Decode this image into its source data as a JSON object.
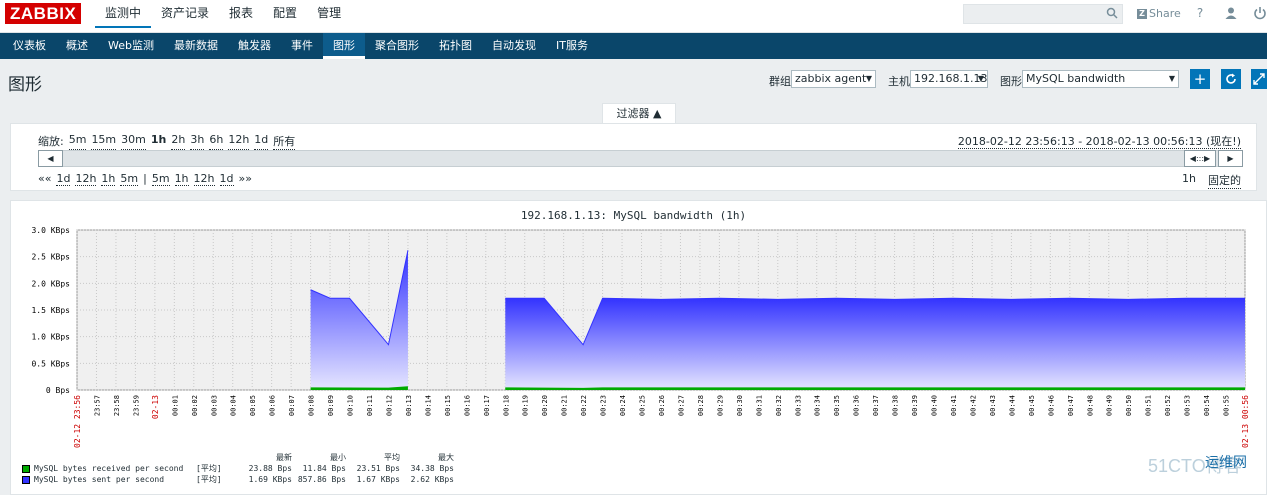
{
  "topbar": {
    "logo": "ZABBIX",
    "menu": [
      "监测中",
      "资产记录",
      "报表",
      "配置",
      "管理"
    ],
    "share_label": "Share",
    "share_icon": "Z",
    "help": "?",
    "user_icon": "user-icon",
    "logout_icon": "power-icon"
  },
  "subnav": [
    "仪表板",
    "概述",
    "Web监测",
    "最新数据",
    "触发器",
    "事件",
    "图形",
    "聚合图形",
    "拓扑图",
    "自动发现",
    "IT服务"
  ],
  "page": {
    "title": "图形",
    "group_label": "群组",
    "group_value": "zabbix agent",
    "host_label": "主机",
    "host_value": "192.168.1.13",
    "graph_label": "图形",
    "graph_value": "MySQL bandwidth",
    "filter_tab": "过滤器 ▲"
  },
  "filter": {
    "zoom_label": "缩放:",
    "zoom_options": [
      "5m",
      "15m",
      "30m",
      "1h",
      "2h",
      "3h",
      "6h",
      "12h",
      "1d",
      "所有"
    ],
    "zoom_current": "1h",
    "range_text": "2018-02-12 23:56:13 - 2018-02-13 00:56:13 (现在!)",
    "nav_back": [
      "««",
      "1d",
      "12h",
      "1h",
      "5m",
      "|",
      "5m",
      "1h",
      "12h",
      "1d",
      "»»"
    ],
    "period": "1h",
    "fixed": "固定的"
  },
  "chart_data": {
    "type": "area",
    "title": "192.168.1.13: MySQL bandwidth (1h)",
    "ylabel": "",
    "y_unit": "KBps",
    "ylim": [
      0,
      3.0
    ],
    "yticks": [
      "0 Bps",
      "0.5 KBps",
      "1.0 KBps",
      "1.5 KBps",
      "2.0 KBps",
      "2.5 KBps",
      "3.0 KBps"
    ],
    "x_ticks": [
      "02-12 23:56",
      "23:57",
      "23:58",
      "23:59",
      "02-13",
      "00:01",
      "00:02",
      "00:03",
      "00:04",
      "00:05",
      "00:06",
      "00:07",
      "00:08",
      "00:09",
      "00:10",
      "00:11",
      "00:12",
      "00:13",
      "00:14",
      "00:15",
      "00:16",
      "00:17",
      "00:18",
      "00:19",
      "00:20",
      "00:21",
      "00:22",
      "00:23",
      "00:24",
      "00:25",
      "00:26",
      "00:27",
      "00:28",
      "00:29",
      "00:30",
      "00:31",
      "00:32",
      "00:33",
      "00:34",
      "00:35",
      "00:36",
      "00:37",
      "00:38",
      "00:39",
      "00:40",
      "00:41",
      "00:42",
      "00:43",
      "00:44",
      "00:45",
      "00:46",
      "00:47",
      "00:48",
      "00:49",
      "00:50",
      "00:51",
      "00:52",
      "00:53",
      "00:54",
      "00:55",
      "02-13 00:56"
    ],
    "red_tick_indices": [
      0,
      4,
      60
    ],
    "series": [
      {
        "name": "MySQL bytes sent per second",
        "color": "#3333ff",
        "segments": [
          [
            [
              12,
              1.88
            ],
            [
              13,
              1.72
            ],
            [
              14,
              1.72
            ],
            [
              16,
              0.85
            ],
            [
              17,
              2.62
            ]
          ],
          [
            [
              22,
              1.72
            ],
            [
              24,
              1.72
            ],
            [
              26,
              0.85
            ],
            [
              27,
              1.72
            ],
            [
              30,
              1.7
            ],
            [
              33,
              1.72
            ],
            [
              36,
              1.7
            ],
            [
              39,
              1.72
            ],
            [
              42,
              1.7
            ],
            [
              45,
              1.72
            ],
            [
              48,
              1.7
            ],
            [
              51,
              1.72
            ],
            [
              54,
              1.7
            ],
            [
              57,
              1.72
            ],
            [
              60,
              1.72
            ]
          ]
        ]
      },
      {
        "name": "MySQL bytes received per second",
        "color": "#00aa00",
        "segments": [
          [
            [
              12,
              0.04
            ],
            [
              16,
              0.035
            ],
            [
              17,
              0.06
            ]
          ],
          [
            [
              22,
              0.04
            ],
            [
              26,
              0.03
            ],
            [
              27,
              0.04
            ],
            [
              60,
              0.04
            ]
          ]
        ]
      }
    ]
  },
  "legend": {
    "headers": [
      "最新",
      "最小",
      "平均",
      "最大"
    ],
    "rows": [
      {
        "name": "MySQL bytes received per second",
        "color": "#00aa00",
        "fn": "[平均]",
        "last": "23.88 Bps",
        "min": "11.84 Bps",
        "avg": "23.51 Bps",
        "max": "34.38 Bps"
      },
      {
        "name": "MySQL bytes sent per second",
        "color": "#3333ff",
        "fn": "[平均]",
        "last": "1.69 KBps",
        "min": "857.86 Bps",
        "avg": "1.67 KBps",
        "max": "2.62 KBps"
      }
    ]
  },
  "watermark": {
    "text1": "51CTO博客",
    "text2": "运维网"
  }
}
